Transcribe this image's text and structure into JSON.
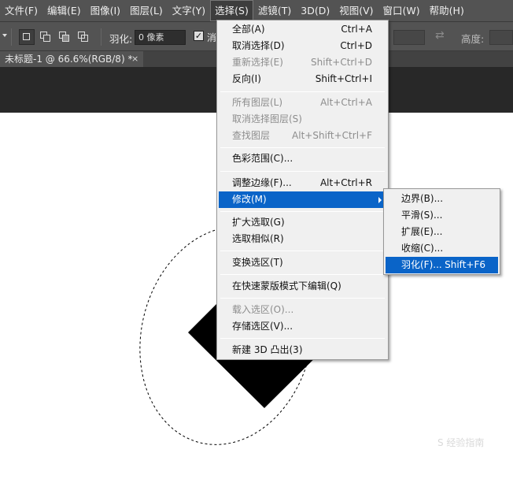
{
  "menubar": {
    "items": [
      "文件(F)",
      "编辑(E)",
      "图像(I)",
      "图层(L)",
      "文字(Y)",
      "选择(S)",
      "滤镜(T)",
      "3D(D)",
      "视图(V)",
      "窗口(W)",
      "帮助(H)"
    ]
  },
  "options": {
    "feather_label": "羽化:",
    "feather_value": "0 像素",
    "antialias_label": "消",
    "height_label": "高度:"
  },
  "document": {
    "tab_title": "未标题-1 @ 66.6%(RGB/8) *",
    "close": "×"
  },
  "select_menu": {
    "groups": [
      [
        {
          "label": "全部(A)",
          "shortcut": "Ctrl+A",
          "enabled": true
        },
        {
          "label": "取消选择(D)",
          "shortcut": "Ctrl+D",
          "enabled": true
        },
        {
          "label": "重新选择(E)",
          "shortcut": "Shift+Ctrl+D",
          "enabled": false
        },
        {
          "label": "反向(I)",
          "shortcut": "Shift+Ctrl+I",
          "enabled": true
        }
      ],
      [
        {
          "label": "所有图层(L)",
          "shortcut": "Alt+Ctrl+A",
          "enabled": false
        },
        {
          "label": "取消选择图层(S)",
          "shortcut": "",
          "enabled": false
        },
        {
          "label": "查找图层",
          "shortcut": "Alt+Shift+Ctrl+F",
          "enabled": false
        }
      ],
      [
        {
          "label": "色彩范围(C)...",
          "shortcut": "",
          "enabled": true
        }
      ],
      [
        {
          "label": "调整边缘(F)...",
          "shortcut": "Alt+Ctrl+R",
          "enabled": true
        },
        {
          "label": "修改(M)",
          "shortcut": "",
          "enabled": true,
          "highlighted": true,
          "submenu": true
        }
      ],
      [
        {
          "label": "扩大选取(G)",
          "shortcut": "",
          "enabled": true
        },
        {
          "label": "选取相似(R)",
          "shortcut": "",
          "enabled": true
        }
      ],
      [
        {
          "label": "变换选区(T)",
          "shortcut": "",
          "enabled": true
        }
      ],
      [
        {
          "label": "在快速蒙版模式下编辑(Q)",
          "shortcut": "",
          "enabled": true
        }
      ],
      [
        {
          "label": "载入选区(O)...",
          "shortcut": "",
          "enabled": false
        },
        {
          "label": "存储选区(V)...",
          "shortcut": "",
          "enabled": true
        }
      ],
      [
        {
          "label": "新建 3D 凸出(3)",
          "shortcut": "",
          "enabled": true
        }
      ]
    ]
  },
  "modify_submenu": {
    "items": [
      {
        "label": "边界(B)...",
        "shortcut": ""
      },
      {
        "label": "平滑(S)...",
        "shortcut": ""
      },
      {
        "label": "扩展(E)...",
        "shortcut": ""
      },
      {
        "label": "收缩(C)...",
        "shortcut": ""
      },
      {
        "label": "羽化(F)...",
        "shortcut": "Shift+F6",
        "highlighted": true
      }
    ]
  },
  "watermark": "S 经验指南",
  "colors": {
    "highlight": "#0a64c8",
    "menu_bg": "#f0f0f0",
    "app_bg": "#535353"
  }
}
